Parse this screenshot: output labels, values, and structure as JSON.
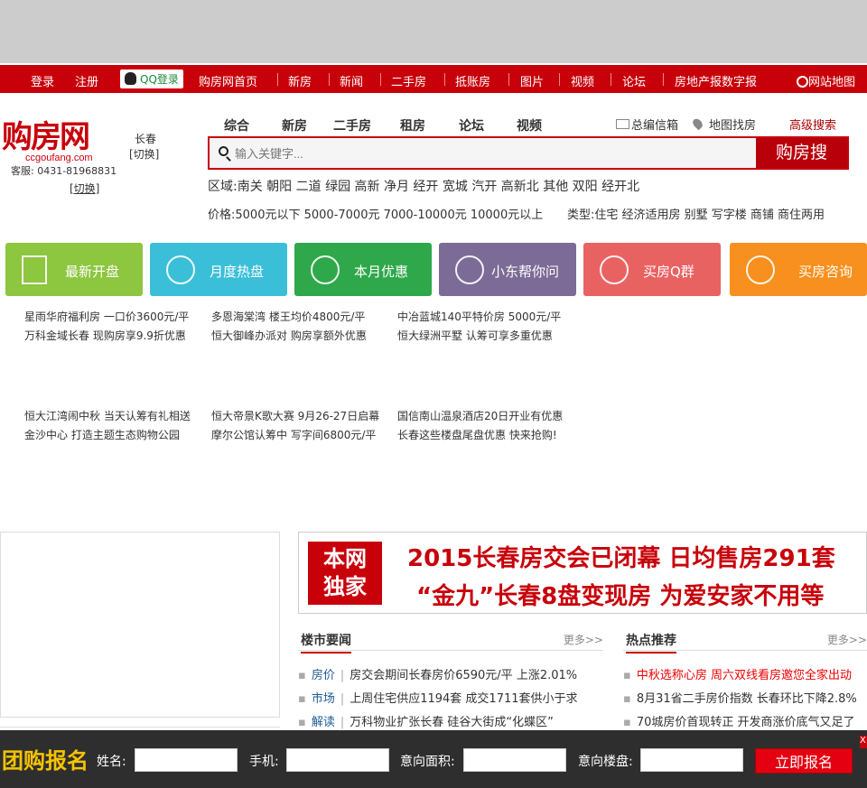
{
  "nav": {
    "login": "登录",
    "register": "注册",
    "qq_login": "QQ登录",
    "items": [
      "购房网首页",
      "新房",
      "新闻",
      "二手房",
      "抵账房",
      "图片",
      "视频",
      "论坛",
      "房地产报数字报"
    ],
    "sitemap": "网站地图"
  },
  "header": {
    "logo_text": "购房网",
    "logo_domain": "ccgoufang.com",
    "city": "长春",
    "switch": "[切换]",
    "service": "客服: 0431-81968831",
    "switch2": "[切换]",
    "tabs": [
      "综合",
      "新房",
      "二手房",
      "租房",
      "论坛",
      "视频"
    ],
    "mailbox": "总编信箱",
    "map_search": "地图找房",
    "advanced_search": "高级搜索",
    "search_placeholder": "输入关键字...",
    "search_button": "购房搜",
    "area_label": "区域:",
    "areas": "南关 朝阳 二道 绿园 高新 净月 经开 宽城 汽开 高新北 其他 双阳 经开北",
    "price_label": "价格:",
    "prices": "5000元以下 5000-7000元 7000-10000元 10000元以上",
    "type_label": "类型:",
    "types": "住宅 经济适用房 别墅 写字楼 商铺 商住两用"
  },
  "features": [
    {
      "label": "最新开盘",
      "color": "#8dc63f",
      "icon": "building-icon"
    },
    {
      "label": "月度热盘",
      "color": "#3bbfd8",
      "icon": "thumbs-up-icon"
    },
    {
      "label": "本月优惠",
      "color": "#2ea84a",
      "icon": "sale-icon"
    },
    {
      "label": "小东帮你问",
      "color": "#7c6b96",
      "icon": "avatar-icon"
    },
    {
      "label": "买房Q群",
      "color": "#e96262",
      "icon": "qq-icon"
    },
    {
      "label": "买房咨询",
      "color": "#f7901e",
      "icon": "phone-icon"
    }
  ],
  "promo": [
    [
      "星雨华府福利房 一口价3600元/平",
      "万科金域长春 现购房享9.9折优惠"
    ],
    [
      "多恩海棠湾 楼王均价4800元/平",
      "恒大御峰办派对 购房享额外优惠"
    ],
    [
      "中冶蓝城140平特价房 5000元/平",
      "恒大绿洲平墅 认筹可享多重优惠"
    ],
    [
      "恒大江湾闹中秋 当天认筹有礼相送",
      "金沙中心 打造主题生态购物公园"
    ],
    [
      "恒大帝景K歌大赛 9月26-27日启幕",
      "摩尔公馆认筹中 写字间6800元/平"
    ],
    [
      "国信南山温泉酒店20日开业有优惠",
      "长春这些楼盘尾盘优惠 快来抢购!"
    ]
  ],
  "banner": {
    "badge1": "本网",
    "badge2": "独家",
    "line1": "2015长春房交会已闭幕 日均售房291套",
    "line2": "“金九”长春8盘变现房 为爱安家不用等"
  },
  "market": {
    "title": "楼市要闻",
    "more": "更多>>",
    "items": [
      {
        "cat": "房价",
        "text": "房交会期间长春房价6590元/平 上涨2.01%"
      },
      {
        "cat": "市场",
        "text": "上周住宅供应1194套 成交1711套供小于求"
      },
      {
        "cat": "解读",
        "text": "万科物业扩张长春 硅谷大街成“化蝶区”"
      }
    ]
  },
  "hot": {
    "title": "热点推荐",
    "more": "更多>>",
    "items": [
      "中秋选称心房 周六双线看房邀您全家出动",
      "8月31省二手房价指数 长春环比下降2.8%",
      "70城房价首现转正 开发商涨价底气又足了"
    ]
  },
  "group": {
    "title": "团购报名",
    "name": "姓名:",
    "phone": "手机:",
    "area": "意向面积:",
    "project": "意向楼盘:",
    "submit": "立即报名",
    "close": "X"
  }
}
